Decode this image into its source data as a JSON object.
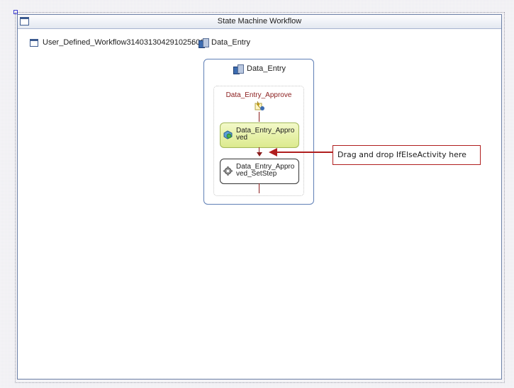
{
  "window": {
    "title": "State Machine Workflow"
  },
  "workflow": {
    "name": "User_Defined_Workflow314031304291025600",
    "separator": ":",
    "current_state": "Data_Entry"
  },
  "state": {
    "name": "Data_Entry",
    "event_driven": {
      "name": "Data_Entry_Approve",
      "activities": [
        {
          "label_line1": "Data_Entry_Appro",
          "label_line2": "ved"
        },
        {
          "label_line1": "Data_Entry_Appro",
          "label_line2": "ved_SetStep"
        }
      ]
    }
  },
  "callout": {
    "text": "Drag and drop IfElseActivity here",
    "color": "#b01e1e"
  },
  "colors": {
    "accent": "#8b1d1d",
    "activity_fill": "#dcea8e",
    "state_border": "#5f7fb6"
  }
}
